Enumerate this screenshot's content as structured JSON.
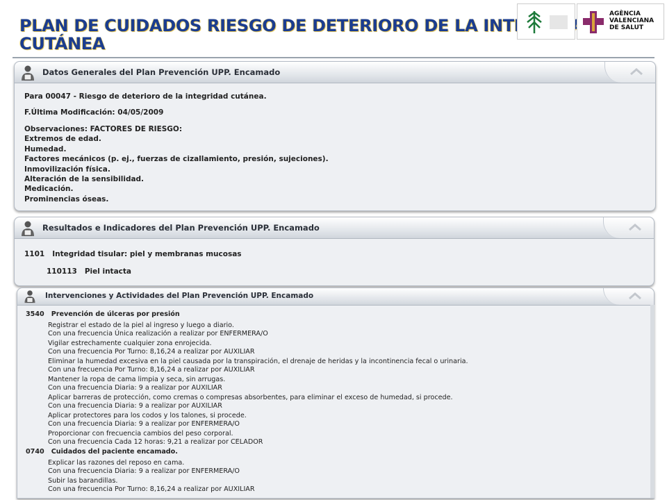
{
  "slide": {
    "title_line1": "PLAN DE CUIDADOS RIESGO DE DETERIORO DE LA INTEGRIDAD",
    "title_line2": "CUTÁNEA"
  },
  "logos": {
    "agency_line1": "AGÈNCIA",
    "agency_line2": "VALENCIANA",
    "agency_line3": "DE SALUT"
  },
  "panel_general": {
    "header": "Datos Generales del Plan Prevención UPP. Encamado",
    "para": "Para 00047 - Riesgo de deterioro de la integridad cutánea.",
    "last_mod_label": "F.Última Modificación:",
    "last_mod_value": "04/05/2009",
    "obs_label": "Observaciones:",
    "obs_title": "FACTORES DE RIESGO:",
    "factors": [
      "Extremos de edad.",
      "Humedad.",
      "Factores mecánicos (p. ej., fuerzas de cizallamiento, presión, sujeciones).",
      "Inmovilización física.",
      "Alteración de la sensibilidad.",
      "Medicación.",
      "Prominencias óseas."
    ]
  },
  "panel_results": {
    "header": "Resultados e Indicadores del Plan Prevención UPP. Encamado",
    "result_code": "1101",
    "result_name": "Integridad tisular: piel y membranas mucosas",
    "indicator_code": "110113",
    "indicator_name": "Piel intacta"
  },
  "panel_interventions": {
    "header": "Intervenciones y Actividades del Plan Prevención UPP. Encamado",
    "interventions": [
      {
        "code": "3540",
        "name": "Prevención de úlceras por presión",
        "activities": [
          {
            "text": "Registrar el estado de la piel al ingreso y luego a diario.",
            "freq": "Con una frecuencia Única realización a realizar por ENFERMERA/O"
          },
          {
            "text": "Vigilar estrechamente cualquier zona enrojecida.",
            "freq": "Con una frecuencia Por Turno: 8,16,24 a realizar por AUXILIAR"
          },
          {
            "text": "Eliminar la humedad excesiva en la piel causada por la transpiración, el drenaje de heridas y la incontinencia fecal o urinaria.",
            "freq": "Con una frecuencia Por Turno: 8,16,24 a realizar por AUXILIAR"
          },
          {
            "text": "Mantener la ropa de cama limpia y seca, sin arrugas.",
            "freq": "Con una frecuencia Diaria: 9 a realizar por AUXILIAR"
          },
          {
            "text": "Aplicar barreras de protección, como cremas o compresas absorbentes, para eliminar el exceso de humedad, si procede.",
            "freq": "Con una frecuencia Diaria: 9 a realizar por AUXILIAR"
          },
          {
            "text": "Aplicar protectores para los codos y los talones, si procede.",
            "freq": "Con una frecuencia Diaria: 9 a realizar por ENFERMERA/O"
          },
          {
            "text": "Proporcionar con frecuencia cambios del peso corporal.",
            "freq": "Con una frecuencia Cada 12 horas: 9,21 a realizar por CELADOR"
          }
        ]
      },
      {
        "code": "0740",
        "name": "Cuidados del paciente encamado.",
        "activities": [
          {
            "text": "Explicar las razones del reposo en cama.",
            "freq": "Con una frecuencia Diaria: 9 a realizar por ENFERMERA/O"
          },
          {
            "text": "Subir las barandillas.",
            "freq": "Con una frecuencia Por Turno: 8,16,24 a realizar por AUXILIAR"
          }
        ]
      }
    ]
  },
  "colors": {
    "title": "#1b3d8f",
    "title_outline": "#e8c85a",
    "panel_bg": "#eef0f3",
    "header_text": "#2a2f38"
  }
}
